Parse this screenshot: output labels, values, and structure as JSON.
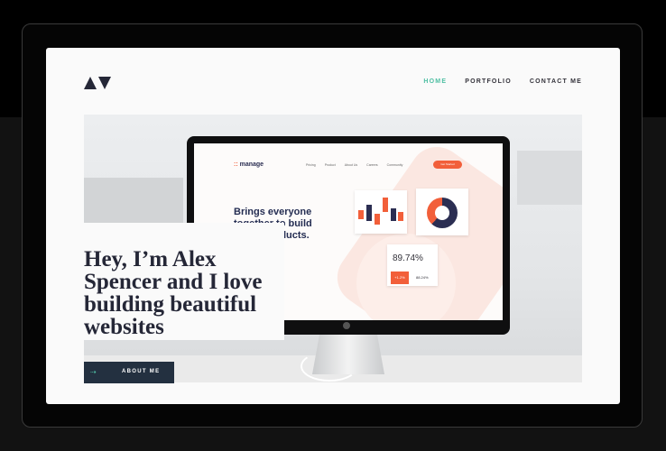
{
  "colors": {
    "accent": "#4fbfa3",
    "dark_navy": "#252737",
    "button_bg": "#233040",
    "orange": "#f25f3a",
    "manage_navy": "#2b2e52"
  },
  "header": {
    "logo_icon": "av-triangles-logo",
    "nav": [
      {
        "label": "HOME",
        "active": true
      },
      {
        "label": "PORTFOLIO",
        "active": false
      },
      {
        "label": "CONTACT ME",
        "active": false
      }
    ]
  },
  "hero": {
    "title": "Hey, I’m Alex Spencer and I love building beautiful websites",
    "button_label": "ABOUT ME",
    "button_icon": "arrow-right-icon"
  },
  "monitor": {
    "brand": "manage",
    "nav": [
      "Pricing",
      "Product",
      "About Us",
      "Careers",
      "Community"
    ],
    "cta": "Get Started",
    "headline": "Brings everyone together to build better products.",
    "stat_main": "89.74%",
    "stat_change": "+1.2%",
    "stat_secondary": "88.24%"
  }
}
